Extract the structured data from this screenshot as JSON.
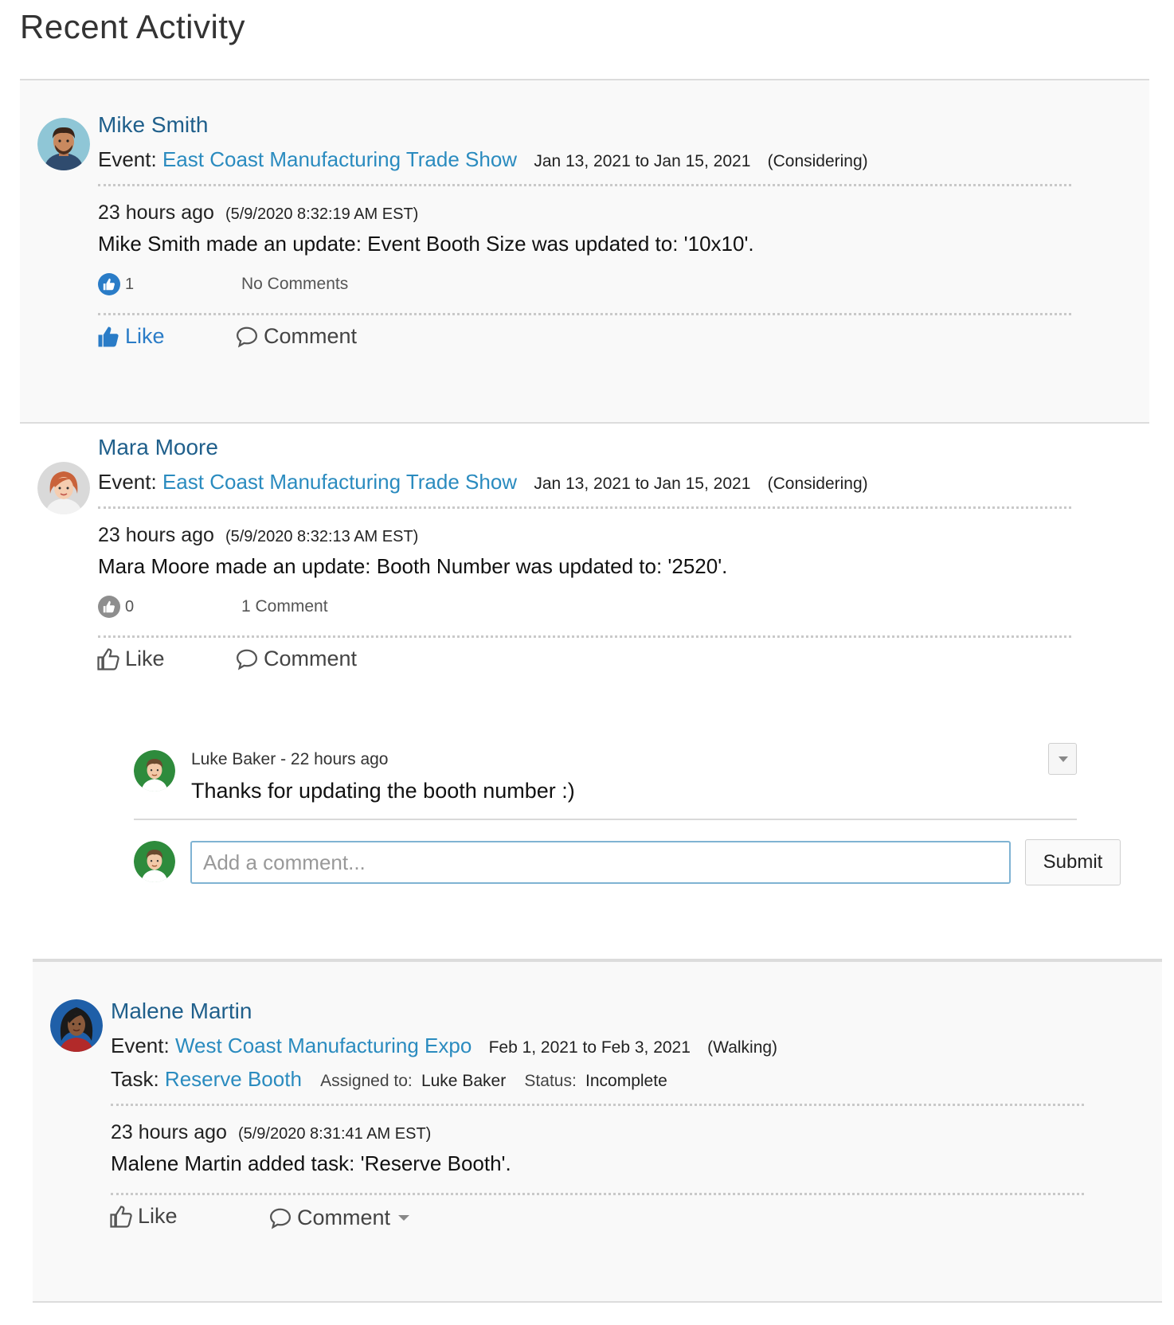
{
  "page": {
    "title": "Recent Activity"
  },
  "colors": {
    "link": "#2a8bbf",
    "name": "#1f5f8b",
    "like_active": "#2a7cc7"
  },
  "activities": [
    {
      "user": "Mike Smith",
      "event_label": "Event:",
      "event_name": "East Coast Manufacturing Trade Show",
      "event_dates": "Jan 13, 2021 to Jan 15, 2021",
      "event_status": "(Considering)",
      "time_ago": "23 hours ago",
      "timestamp": "(5/9/2020 8:32:19 AM EST)",
      "message": "Mike Smith made an update: Event Booth Size was updated to: '10x10'.",
      "like_count": "1",
      "comments_label": "No Comments",
      "like_label": "Like",
      "comment_label": "Comment",
      "liked": true
    },
    {
      "user": "Mara Moore",
      "event_label": "Event:",
      "event_name": "East Coast Manufacturing Trade Show",
      "event_dates": "Jan 13, 2021 to Jan 15, 2021",
      "event_status": "(Considering)",
      "time_ago": "23 hours ago",
      "timestamp": "(5/9/2020 8:32:13 AM EST)",
      "message": "Mara Moore made an update: Booth Number was updated to: '2520'.",
      "like_count": "0",
      "comments_label": "1 Comment",
      "like_label": "Like",
      "comment_label": "Comment",
      "liked": false,
      "comments": [
        {
          "author": "Luke Baker - 22 hours ago",
          "text": "Thanks for updating the booth number :)"
        }
      ],
      "new_comment": {
        "placeholder": "Add a comment...",
        "submit_label": "Submit"
      }
    },
    {
      "user": "Malene Martin",
      "event_label": "Event:",
      "event_name": "West Coast Manufacturing Expo",
      "event_dates": "Feb 1, 2021 to Feb 3, 2021",
      "event_status": "(Walking)",
      "task_label": "Task:",
      "task_name": "Reserve Booth",
      "assigned_label": "Assigned to:",
      "assigned_to": "Luke Baker",
      "status_label": "Status:",
      "status": "Incomplete",
      "time_ago": "23 hours ago",
      "timestamp": "(5/9/2020 8:31:41 AM EST)",
      "message": "Malene Martin added task: 'Reserve Booth'.",
      "like_label": "Like",
      "comment_label": "Comment",
      "liked": false
    }
  ]
}
